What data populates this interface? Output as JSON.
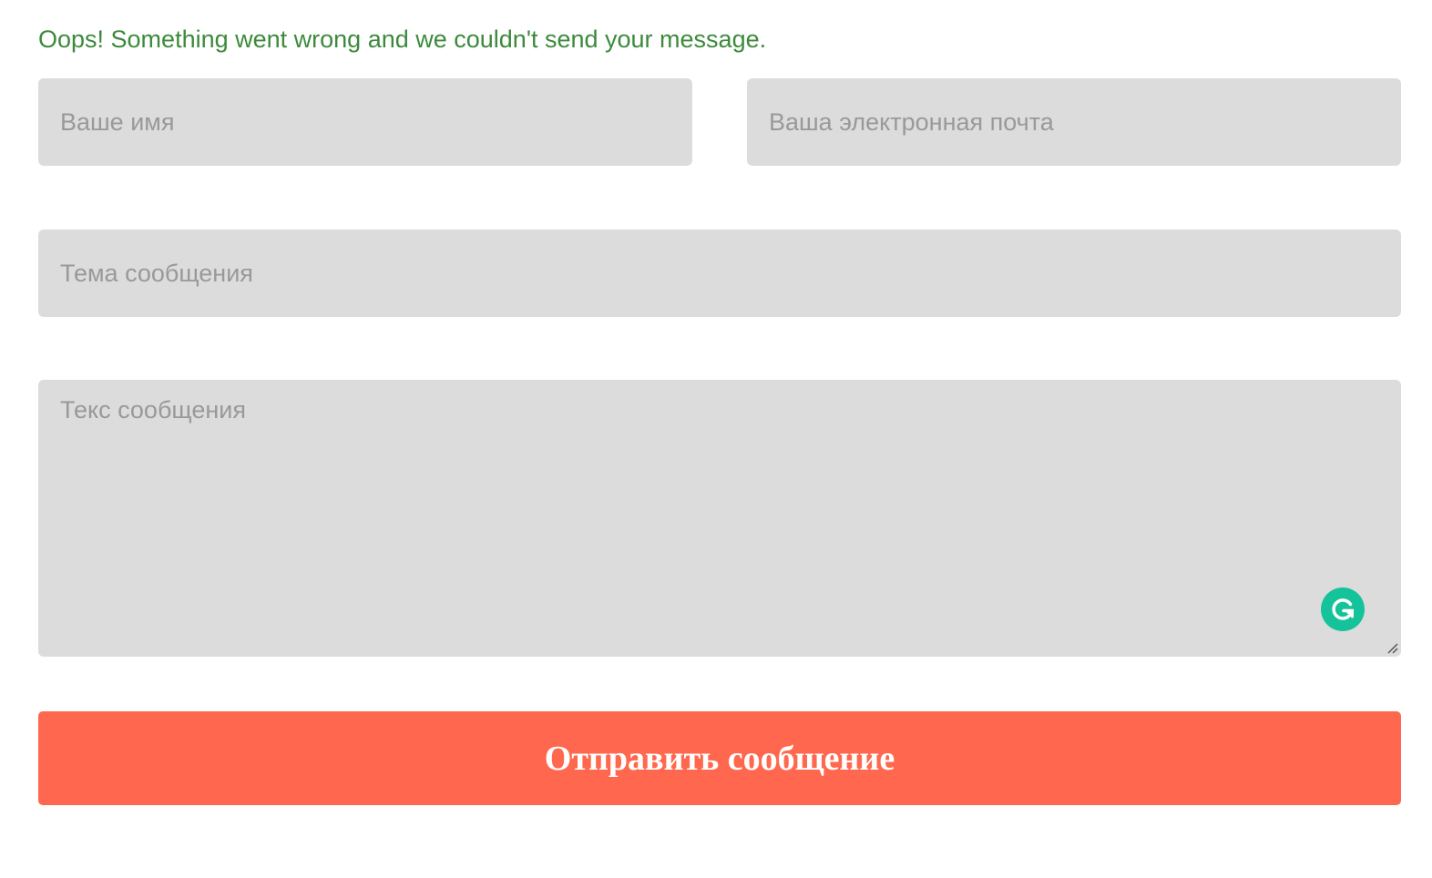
{
  "form": {
    "error_message": "Oops! Something went wrong and we couldn't send your message.",
    "name_placeholder": "Ваше имя",
    "email_placeholder": "Ваша электронная почта",
    "subject_placeholder": "Тема сообщения",
    "message_placeholder": "Текс сообщения",
    "submit_label": "Отправить сообщение"
  },
  "icons": {
    "grammarly": "grammarly-icon",
    "resize": "resize-handle-icon"
  },
  "colors": {
    "error_text": "#3c8a3c",
    "field_background": "#dcdcdc",
    "placeholder": "#999999",
    "submit_background": "#ff684e",
    "submit_text": "#ffffff",
    "grammarly": "#15c39a"
  }
}
